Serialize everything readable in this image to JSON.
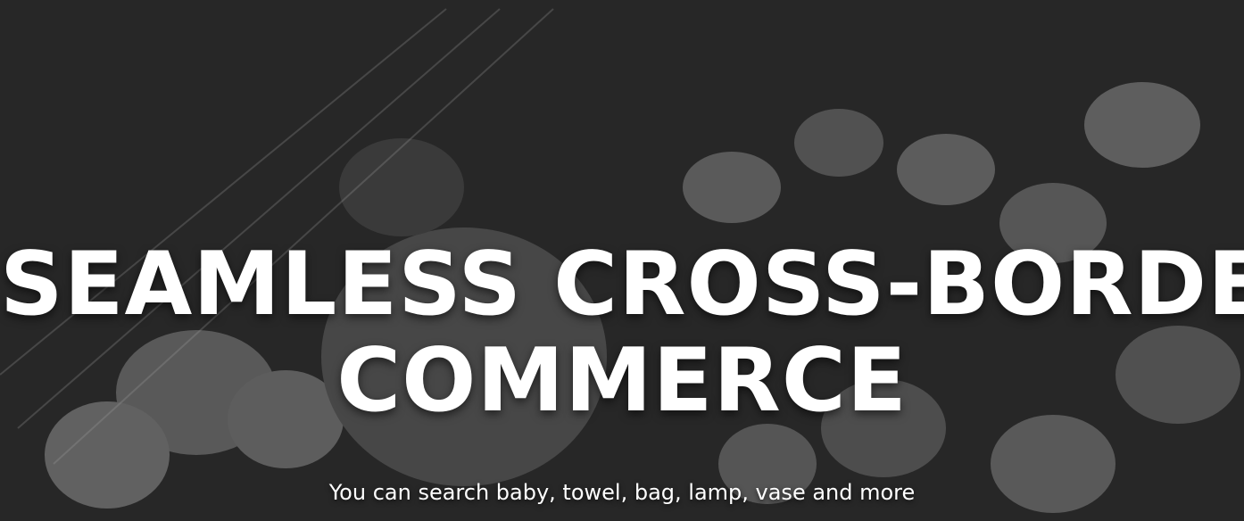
{
  "hero": {
    "headline_line1": "SEAMLESS CROSS-BORDER",
    "headline_line2": "COMMERCE",
    "subtitle": "You can search baby, towel, bag, lamp, vase and more"
  }
}
